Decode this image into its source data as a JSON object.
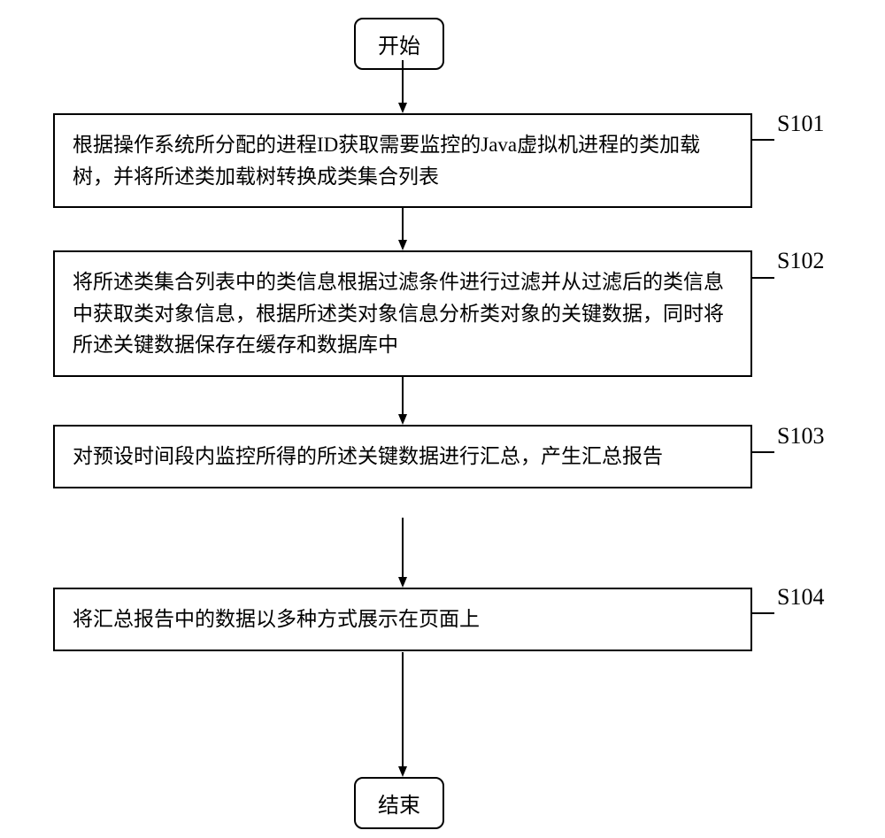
{
  "flowchart": {
    "start": "开始",
    "end": "结束",
    "steps": [
      {
        "label": "S101",
        "text": "根据操作系统所分配的进程ID获取需要监控的Java虚拟机进程的类加载树，并将所述类加载树转换成类集合列表"
      },
      {
        "label": "S102",
        "text": "将所述类集合列表中的类信息根据过滤条件进行过滤并从过滤后的类信息中获取类对象信息，根据所述类对象信息分析类对象的关键数据，同时将所述关键数据保存在缓存和数据库中"
      },
      {
        "label": "S103",
        "text": "对预设时间段内监控所得的所述关键数据进行汇总，产生汇总报告"
      },
      {
        "label": "S104",
        "text": "将汇总报告中的数据以多种方式展示在页面上"
      }
    ]
  }
}
